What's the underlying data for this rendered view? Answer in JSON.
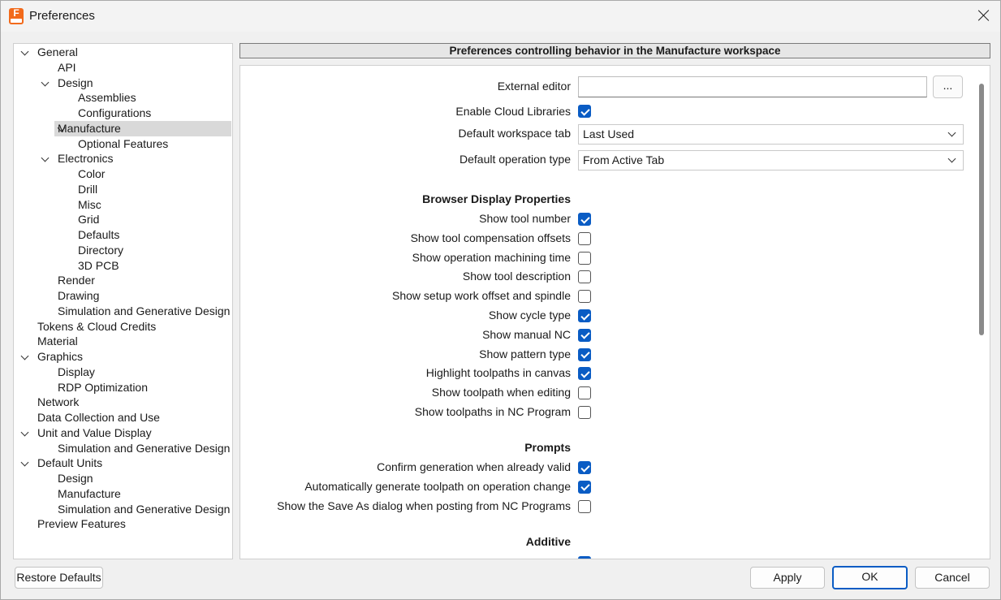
{
  "window": {
    "title": "Preferences",
    "app_icon_letter": "F"
  },
  "tree": [
    {
      "label": "General",
      "expanded": true,
      "level": 0
    },
    {
      "label": "API",
      "level": 1
    },
    {
      "label": "Design",
      "expanded": true,
      "level": 1
    },
    {
      "label": "Assemblies",
      "level": 2
    },
    {
      "label": "Configurations",
      "level": 2
    },
    {
      "label": "Manufacture",
      "expanded": true,
      "level": 1,
      "selected": true
    },
    {
      "label": "Optional Features",
      "level": 2
    },
    {
      "label": "Electronics",
      "expanded": true,
      "level": 1
    },
    {
      "label": "Color",
      "level": 2
    },
    {
      "label": "Drill",
      "level": 2
    },
    {
      "label": "Misc",
      "level": 2
    },
    {
      "label": "Grid",
      "level": 2
    },
    {
      "label": "Defaults",
      "level": 2
    },
    {
      "label": "Directory",
      "level": 2
    },
    {
      "label": "3D PCB",
      "level": 2
    },
    {
      "label": "Render",
      "level": 1
    },
    {
      "label": "Drawing",
      "level": 1
    },
    {
      "label": "Simulation and Generative Design",
      "level": 1
    },
    {
      "label": "Tokens & Cloud Credits",
      "level": 0
    },
    {
      "label": "Material",
      "level": 0
    },
    {
      "label": "Graphics",
      "expanded": true,
      "level": 0
    },
    {
      "label": "Display",
      "level": 1
    },
    {
      "label": "RDP Optimization",
      "level": 1
    },
    {
      "label": "Network",
      "level": 0
    },
    {
      "label": "Data Collection and Use",
      "level": 0
    },
    {
      "label": "Unit and Value Display",
      "expanded": true,
      "level": 0
    },
    {
      "label": "Simulation and Generative Design",
      "level": 1
    },
    {
      "label": "Default Units",
      "expanded": true,
      "level": 0
    },
    {
      "label": "Design",
      "level": 1
    },
    {
      "label": "Manufacture",
      "level": 1
    },
    {
      "label": "Simulation and Generative Design",
      "level": 1
    },
    {
      "label": "Preview Features",
      "level": 0
    }
  ],
  "header": {
    "title": "Preferences controlling behavior in the Manufacture workspace"
  },
  "general": {
    "external_editor_label": "External editor",
    "external_editor_value": "",
    "browse_label": "...",
    "cloud_libraries_label": "Enable Cloud Libraries",
    "cloud_libraries_checked": true,
    "workspace_tab_label": "Default workspace tab",
    "workspace_tab_value": "Last Used",
    "operation_type_label": "Default operation type",
    "operation_type_value": "From Active Tab"
  },
  "browser_display": {
    "heading": "Browser Display Properties",
    "items": [
      {
        "label": "Show tool number",
        "checked": true
      },
      {
        "label": "Show tool compensation offsets",
        "checked": false
      },
      {
        "label": "Show operation machining time",
        "checked": false
      },
      {
        "label": "Show tool description",
        "checked": false
      },
      {
        "label": "Show setup work offset and spindle",
        "checked": false
      },
      {
        "label": "Show cycle type",
        "checked": true
      },
      {
        "label": "Show manual NC",
        "checked": true
      },
      {
        "label": "Show pattern type",
        "checked": true
      },
      {
        "label": "Highlight toolpaths in canvas",
        "checked": true
      },
      {
        "label": "Show toolpath when editing",
        "checked": false
      },
      {
        "label": "Show toolpaths in NC Program",
        "checked": false
      }
    ]
  },
  "prompts": {
    "heading": "Prompts",
    "items": [
      {
        "label": "Confirm generation when already valid",
        "checked": true
      },
      {
        "label": "Automatically generate toolpath on operation change",
        "checked": true
      },
      {
        "label": "Show the Save As dialog when posting from NC Programs",
        "checked": false
      }
    ]
  },
  "additive": {
    "heading": "Additive",
    "items": [
      {
        "label": "",
        "checked": true
      }
    ]
  },
  "buttons": {
    "restore": "Restore Defaults",
    "apply": "Apply",
    "ok": "OK",
    "cancel": "Cancel"
  }
}
